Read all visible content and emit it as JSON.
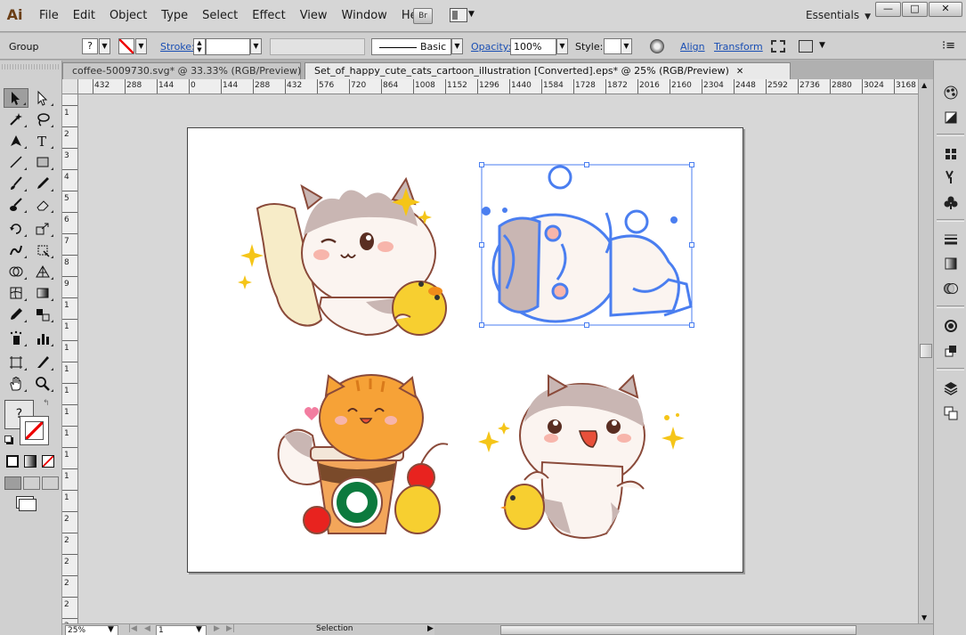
{
  "app": {
    "logo": "Ai",
    "workspace": "Essentials"
  },
  "menus": [
    "File",
    "Edit",
    "Object",
    "Type",
    "Select",
    "Effect",
    "View",
    "Window",
    "Help"
  ],
  "menubar": {
    "bridge_label": "Br",
    "min": "—",
    "max": "□",
    "close": "✕"
  },
  "control": {
    "selection_type": "Group",
    "fill_value": "?",
    "stroke_label": "Stroke:",
    "stroke_weight": "",
    "brush_profile": "Basic",
    "opacity_label": "Opacity:",
    "opacity_value": "100%",
    "style_label": "Style:",
    "align_label": "Align",
    "transform_label": "Transform"
  },
  "tabs": [
    {
      "label": "coffee-5009730.svg* @ 33.33% (RGB/Preview)",
      "active": false
    },
    {
      "label": "Set_of_happy_cute_cats_cartoon_illustration [Converted].eps* @ 25% (RGB/Preview)",
      "active": true
    }
  ],
  "ruler": {
    "h_ticks": [
      "432",
      "288",
      "144",
      "0",
      "144",
      "288",
      "432",
      "576",
      "720",
      "864",
      "1008",
      "1152",
      "1296",
      "1440",
      "1584",
      "1728",
      "1872",
      "2016",
      "2160",
      "2304",
      "2448",
      "2592",
      "2736",
      "2880",
      "3024",
      "3168"
    ],
    "v_ticks": [
      "1",
      "2",
      "3",
      "4",
      "5",
      "6",
      "7",
      "8",
      "9",
      "1",
      "1",
      "1",
      "1",
      "1",
      "1",
      "1",
      "1",
      "1",
      "1",
      "2",
      "2",
      "2",
      "2",
      "2",
      "2"
    ]
  },
  "status": {
    "zoom": "25%",
    "artboard_number": "1",
    "tool": "Selection"
  },
  "toolbox": {
    "fill_swatch": "?"
  },
  "icons": {
    "selection": "selection-tool-icon",
    "direct_selection": "direct-selection-tool-icon",
    "magic_wand": "magic-wand-tool-icon",
    "lasso": "lasso-tool-icon",
    "pen": "pen-tool-icon",
    "type": "type-tool-icon",
    "line": "line-segment-tool-icon",
    "rectangle": "rectangle-tool-icon",
    "paintbrush": "paintbrush-tool-icon",
    "pencil": "pencil-tool-icon",
    "blob_brush": "blob-brush-tool-icon",
    "eraser": "eraser-tool-icon",
    "rotate": "rotate-tool-icon",
    "scale": "scale-tool-icon",
    "warp": "warp-tool-icon",
    "free_transform": "free-transform-tool-icon",
    "shape_builder": "shape-builder-tool-icon",
    "perspective": "perspective-grid-tool-icon",
    "mesh": "mesh-tool-icon",
    "gradient": "gradient-tool-icon",
    "eyedropper": "eyedropper-tool-icon",
    "blend": "blend-tool-icon",
    "symbol_sprayer": "symbol-sprayer-tool-icon",
    "column_graph": "column-graph-tool-icon",
    "artboard": "artboard-tool-icon",
    "slice": "slice-tool-icon",
    "hand": "hand-tool-icon",
    "zoom": "zoom-tool-icon"
  },
  "colors": {
    "accent": "#2f6bd8",
    "selection_blue": "#4a7ef0",
    "cat_cream": "#fbf4f0",
    "cat_patch": "#c9b6b3",
    "cat_outline": "#8a4a3a",
    "orange_cat": "#f6a237",
    "duck_yellow": "#f7cf30",
    "cherry_red": "#e8231f",
    "starbucks_green": "#0c7a3e",
    "sparkle": "#f5c518"
  }
}
